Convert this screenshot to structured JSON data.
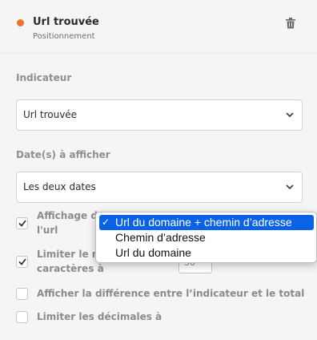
{
  "item": {
    "title": "Url trouvée",
    "subtitle": "Positionnement",
    "status_color": "#f0702e"
  },
  "indicateur": {
    "label": "Indicateur",
    "value": "Url trouvée"
  },
  "dates": {
    "label": "Date(s) à afficher",
    "value": "Les deux dates"
  },
  "options": [
    {
      "line1": "Affichage de",
      "line2": "l'url",
      "checked": true
    },
    {
      "line1": "Limiter le no",
      "line2": "caractères à",
      "checked": true,
      "input_value": "30"
    },
    {
      "line1": "Afficher la différence entre l’indicateur et le total",
      "checked": false
    },
    {
      "line1": "Limiter les décimales à",
      "checked": false
    }
  ],
  "dropdown": {
    "selected_index": 0,
    "items": [
      "Url du domaine + chemin d’adresse",
      "Chemin d’adresse",
      "Url du domaine"
    ],
    "check_glyph": "✓"
  },
  "icons": {
    "delete": "trash-icon",
    "select_arrow": "chevron-down-icon",
    "checkbox_mark": "check-icon"
  }
}
